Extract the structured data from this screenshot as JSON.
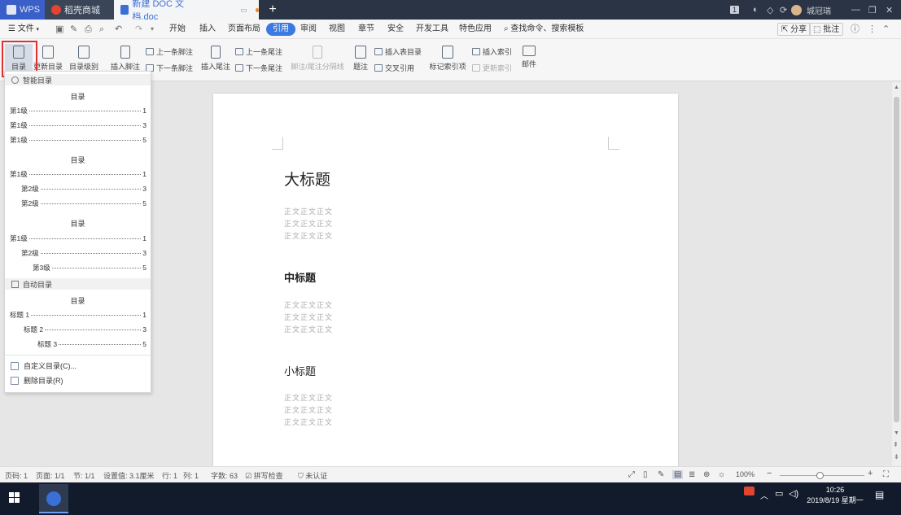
{
  "tabs": {
    "wps": "WPS",
    "daoke": "稻壳商城",
    "doc": "新建 DOC 文档.doc",
    "add": "+"
  },
  "titlebar": {
    "page_badge": "1",
    "user_name": "城冠瑞",
    "minimize": "—",
    "restore": "❐",
    "close": "✕"
  },
  "menubar": {
    "file": "文件",
    "items": [
      "开始",
      "插入",
      "页面布局",
      "引用",
      "审阅",
      "视图",
      "章节",
      "安全",
      "开发工具",
      "特色应用"
    ],
    "search": "查找命令、搜索模板",
    "share": "分享",
    "comment": "批注"
  },
  "ribbon": {
    "toc": "目录",
    "update_toc": "更新目录",
    "toc_level": "目录级别",
    "insert_footnote": "插入脚注",
    "prev_footnote": "上一条脚注",
    "next_footnote": "下一条脚注",
    "insert_endnote": "插入尾注",
    "prev_endnote": "上一条尾注",
    "next_endnote": "下一条尾注",
    "footnote_sep": "脚注/尾注分隔线",
    "caption": "题注",
    "insert_table_toc": "插入表目录",
    "cross_ref": "交叉引用",
    "mark_index": "标记索引项",
    "insert_index": "插入索引",
    "update_index": "更新索引",
    "mail": "邮件"
  },
  "dropdown": {
    "smart_section": "智能目录",
    "auto_section": "自动目录",
    "toc_title": "目录",
    "group1": [
      {
        "label": "第1级",
        "page": "1"
      },
      {
        "label": "第1级",
        "page": "3"
      },
      {
        "label": "第1级",
        "page": "5"
      }
    ],
    "group2": [
      {
        "label": "第1级",
        "page": "1"
      },
      {
        "label": "第2级",
        "page": "3"
      },
      {
        "label": "第2级",
        "page": "5"
      }
    ],
    "group3": [
      {
        "label": "第1级",
        "page": "1"
      },
      {
        "label": "第2级",
        "page": "3"
      },
      {
        "label": "第3级",
        "page": "5"
      }
    ],
    "group4": [
      {
        "label": "标题 1",
        "page": "1"
      },
      {
        "label": "标题 2",
        "page": "3"
      },
      {
        "label": "标题 3",
        "page": "5"
      }
    ],
    "custom": "自定义目录(C)...",
    "delete": "删除目录(R)"
  },
  "document": {
    "h1": "大标题",
    "h2": "中标题",
    "h3": "小标题",
    "body_text": "正文正文正文"
  },
  "statusbar": {
    "page_no": "页码: 1",
    "pages": "页面: 1/1",
    "section": "节: 1/1",
    "setting": "设置值: 3.1厘米",
    "row": "行: 1",
    "col": "列: 1",
    "word_count": "字数: 63",
    "spell_check": "拼写检查",
    "auth": "未认证",
    "zoom": "100%"
  },
  "taskbar": {
    "time": "10:26",
    "date": "2019/8/19 星期一"
  },
  "colors": {
    "accent": "#3c79e0",
    "titlebar": "#2b3445",
    "highlight_box": "#e03030"
  }
}
